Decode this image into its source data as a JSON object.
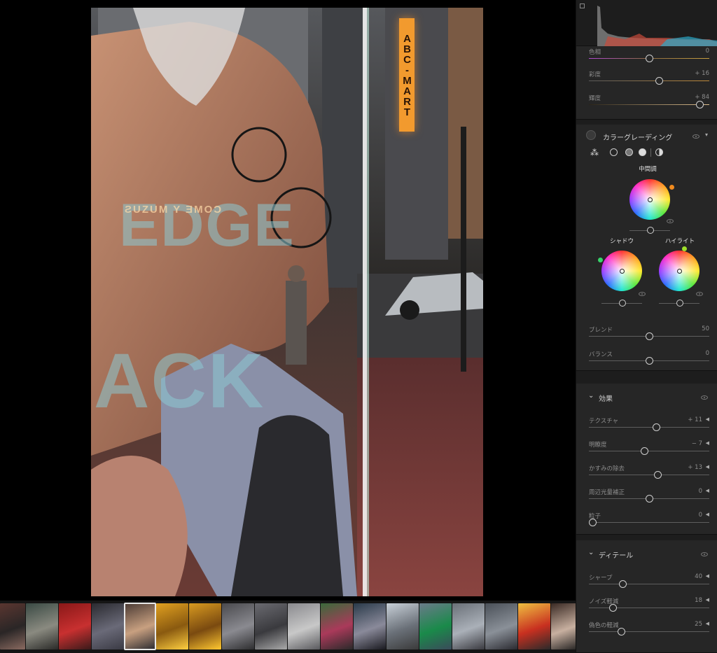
{
  "colors": {
    "panel_bg": "#262626",
    "accent_orange": "#f29a2e",
    "sign_text": "#2b1405",
    "highlight_handle": "#9fe02a",
    "shadow_handle": "#37d46a",
    "mid_handle": "#f08a1e"
  },
  "photo": {
    "sign_text": "ABC-MART",
    "overlay_word_1": "EDGE",
    "overlay_word_2": "ACK",
    "mirrored_text": "ƧUZUM Y ƎMOƆ"
  },
  "hsl": {
    "rows": [
      {
        "label": "色相",
        "value": "0",
        "percent": 50
      },
      {
        "label": "彩度",
        "value": "+ 16",
        "percent": 58
      },
      {
        "label": "輝度",
        "value": "+ 84",
        "percent": 92
      }
    ]
  },
  "color_grading": {
    "title": "カラーグレーディング",
    "icons": [
      "three-circles-icon",
      "shadow-circle-icon",
      "midtone-circle-icon",
      "highlight-circle-icon",
      "global-half-circle-icon"
    ],
    "midtones_label": "中間調",
    "shadows_label": "シャドウ",
    "highlights_label": "ハイライト",
    "blend": {
      "label": "ブレンド",
      "value": "50",
      "percent": 50
    },
    "balance": {
      "label": "バランス",
      "value": "0",
      "percent": 50
    }
  },
  "effects": {
    "title": "効果",
    "rows": [
      {
        "label": "テクスチャ",
        "value": "+ 11",
        "percent": 56
      },
      {
        "label": "明瞭度",
        "value": "− 7",
        "percent": 46
      },
      {
        "label": "かすみの除去",
        "value": "+ 13",
        "percent": 57
      },
      {
        "label": "周辺光量補正",
        "value": "0",
        "percent": 50
      },
      {
        "label": "粒子",
        "value": "0",
        "percent": 3
      }
    ]
  },
  "detail": {
    "title": "ディテール",
    "rows": [
      {
        "label": "シャープ",
        "value": "40",
        "percent": 28
      },
      {
        "label": "ノイズ軽減",
        "value": "18",
        "percent": 20
      },
      {
        "label": "偽色の軽減",
        "value": "25",
        "percent": 27
      }
    ]
  },
  "filmstrip": {
    "selected_index": 4,
    "thumbs": [
      {
        "colors": [
          "#5a3630",
          "#2a2626",
          "#8a6a60"
        ]
      },
      {
        "colors": [
          "#3a4a44",
          "#8a8a80",
          "#2a2a28"
        ]
      },
      {
        "colors": [
          "#8a1818",
          "#c83030",
          "#3a1a1a"
        ]
      },
      {
        "colors": [
          "#2a2a30",
          "#6a6a78",
          "#3a3a44"
        ]
      },
      {
        "colors": [
          "#4a3a34",
          "#c8a080",
          "#2a2a30"
        ]
      },
      {
        "colors": [
          "#e0a020",
          "#8a5a10",
          "#ffd040"
        ]
      },
      {
        "colors": [
          "#d89a20",
          "#7a4a10",
          "#ffc830"
        ]
      },
      {
        "colors": [
          "#4a4a4e",
          "#8a8a90",
          "#2e2e30"
        ]
      },
      {
        "colors": [
          "#6a6a70",
          "#3a3a3e",
          "#aaaaaa"
        ]
      },
      {
        "colors": [
          "#8a8a8e",
          "#c8c8c8",
          "#5a5a5e"
        ]
      },
      {
        "colors": [
          "#3a6a3a",
          "#aa3a5a",
          "#2a2a2a"
        ]
      },
      {
        "colors": [
          "#2a3a4a",
          "#8a8a9a",
          "#1a1a20"
        ]
      },
      {
        "colors": [
          "#c8d0d8",
          "#6a7078",
          "#3a3a3a"
        ]
      },
      {
        "colors": [
          "#6a7a8a",
          "#1a8a4a",
          "#3a4a5a"
        ]
      },
      {
        "colors": [
          "#6a7078",
          "#aab0b8",
          "#3a3a40"
        ]
      },
      {
        "colors": [
          "#4a5058",
          "#8a9098",
          "#2a2a30"
        ]
      },
      {
        "colors": [
          "#f0c040",
          "#c83020",
          "#2a2a2a"
        ]
      },
      {
        "colors": [
          "#3a2a24",
          "#c8b0a0",
          "#1a1a1a"
        ]
      }
    ]
  }
}
